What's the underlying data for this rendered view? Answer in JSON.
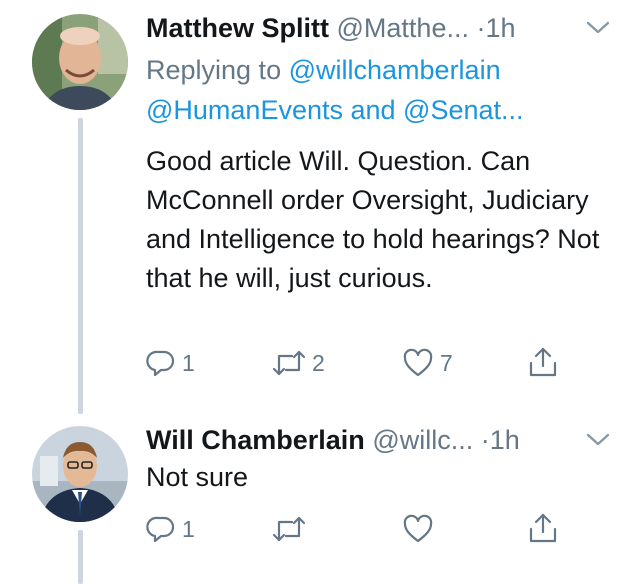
{
  "tweets": [
    {
      "author_name": "Matthew Splitt",
      "handle": "@Matthe...",
      "dot": "·",
      "time": "1h",
      "replying_prefix": "Replying to",
      "reply_handle_1": "@willchamberlain",
      "reply_handles_rest": "@HumanEvents and @Senat...",
      "text": "Good article Will. Question. Can McConnell order Oversight, Judiciary and Intelligence to hold hearings? Not that he will, just curious.",
      "replies": "1",
      "retweets": "2",
      "likes": "7"
    },
    {
      "author_name": "Will Chamberlain",
      "handle": "@willc...",
      "dot": "·",
      "time": "1h",
      "text": "Not sure",
      "replies": "1",
      "retweets": "",
      "likes": ""
    }
  ],
  "icons": [
    "reply-icon",
    "retweet-icon",
    "like-icon",
    "share-icon",
    "chevron-down-icon"
  ],
  "colors": {
    "link": "#1b95e0",
    "muted": "#657786",
    "thread_line": "#cdd6dd"
  }
}
